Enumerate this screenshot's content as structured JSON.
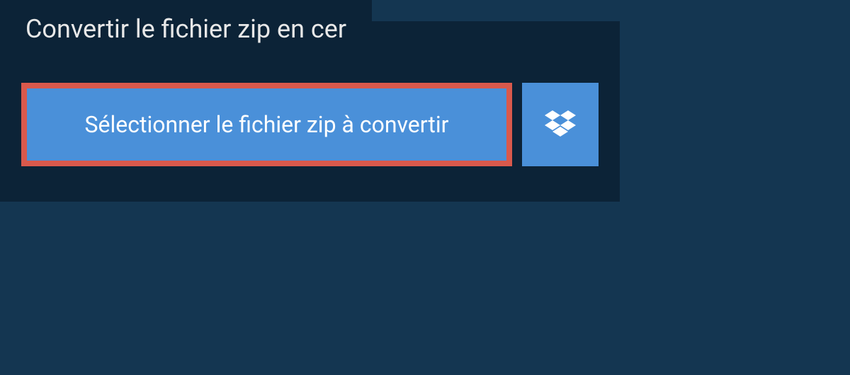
{
  "tab": {
    "title": "Convertir le fichier zip en cer"
  },
  "actions": {
    "select_file_label": "Sélectionner le fichier zip à convertir"
  },
  "colors": {
    "background": "#143651",
    "panel": "#0c2337",
    "button": "#4a90d9",
    "highlight_border": "#d9594c"
  }
}
